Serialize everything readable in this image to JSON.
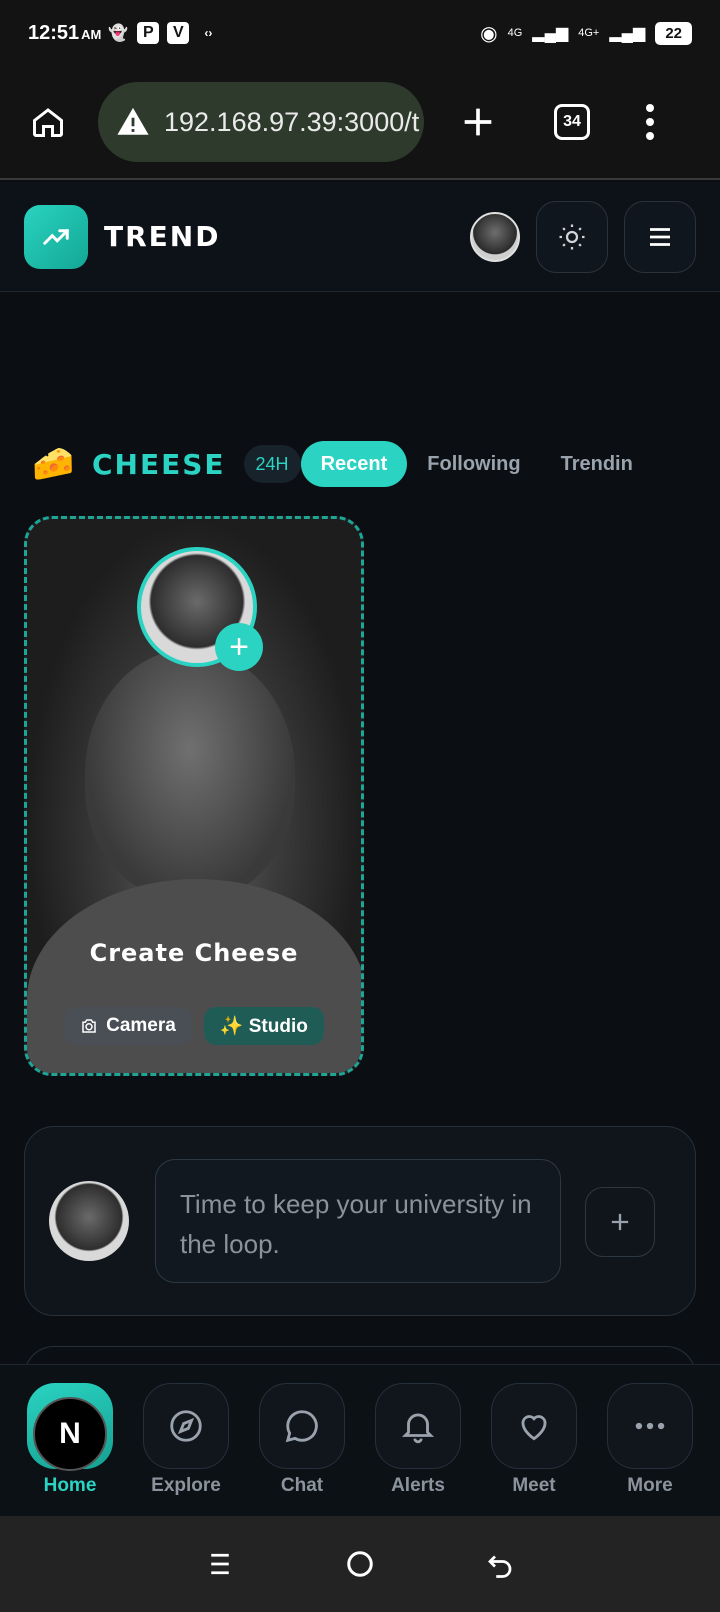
{
  "status_bar": {
    "time": "12:51",
    "ampm": "AM",
    "net1": "4G",
    "net2": "4G+",
    "battery": "22"
  },
  "browser": {
    "url": "192.168.97.39:3000/t",
    "tab_count": "34"
  },
  "header": {
    "brand": "TREND"
  },
  "cheese": {
    "emoji": "🧀",
    "title": "CHEESE",
    "badge": "24H",
    "tabs": [
      "Recent",
      "Following",
      "Trendin"
    ],
    "active_tab": "Recent"
  },
  "create_card": {
    "title": "Create Cheese",
    "camera_label": "Camera",
    "studio_label": "✨ Studio"
  },
  "composer": {
    "placeholder": "Time to keep your university in the loop."
  },
  "bottom_nav": {
    "home_logo": "N",
    "items": [
      "Home",
      "Explore",
      "Chat",
      "Alerts",
      "Meet",
      "More"
    ],
    "active": "Home"
  },
  "colors": {
    "accent": "#2ad3c2",
    "background": "#0b0f14"
  }
}
